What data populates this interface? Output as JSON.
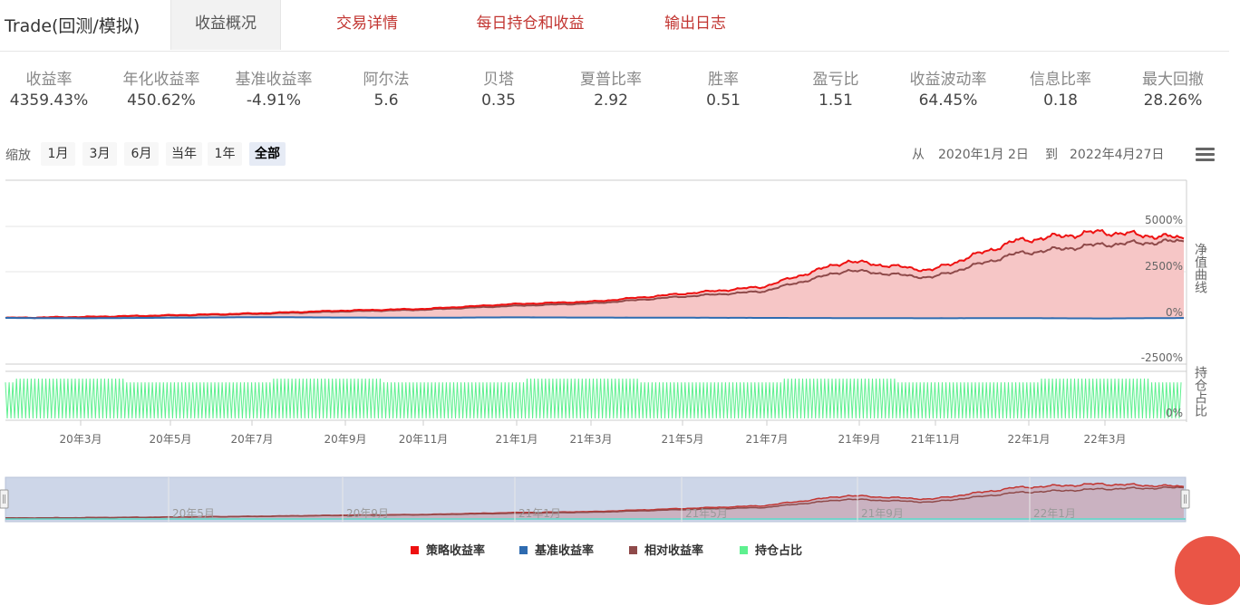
{
  "app_title": "Trade(回测/模拟)",
  "tabs": [
    {
      "label": "收益概况",
      "active": true
    },
    {
      "label": "交易详情",
      "active": false
    },
    {
      "label": "每日持仓和收益",
      "active": false
    },
    {
      "label": "输出日志",
      "active": false
    }
  ],
  "stats": [
    {
      "label": "收益率",
      "value": "4359.43%"
    },
    {
      "label": "年化收益率",
      "value": "450.62%"
    },
    {
      "label": "基准收益率",
      "value": "-4.91%"
    },
    {
      "label": "阿尔法",
      "value": "5.6"
    },
    {
      "label": "贝塔",
      "value": "0.35"
    },
    {
      "label": "夏普比率",
      "value": "2.92"
    },
    {
      "label": "胜率",
      "value": "0.51"
    },
    {
      "label": "盈亏比",
      "value": "1.51"
    },
    {
      "label": "收益波动率",
      "value": "64.45%"
    },
    {
      "label": "信息比率",
      "value": "0.18"
    },
    {
      "label": "最大回撤",
      "value": "28.26%"
    }
  ],
  "zoom": {
    "label": "缩放",
    "buttons": [
      "1月",
      "3月",
      "6月",
      "当年",
      "1年",
      "全部"
    ],
    "selected": "全部"
  },
  "range": {
    "from_label": "从",
    "from": "2020年1月 2日",
    "to_label": "到",
    "to": "2022年4月27日"
  },
  "colors": {
    "strategy": "#ee1111",
    "benchmark": "#2e6bb0",
    "relative": "#8f4a4a",
    "position": "#5ef08f",
    "area_fill": "#f6c6c6",
    "navigator_bg": "#cdd6e8",
    "accent": "#c23531"
  },
  "chart_data": {
    "type": "line",
    "right_axis_title": "净值曲线",
    "position_axis_title": "持仓占比",
    "y_ticks": [
      "5000%",
      "2500%",
      "0%",
      "-2500%"
    ],
    "position_tick": "0%",
    "ylim": [
      -2500,
      5000
    ],
    "x_ticks": [
      "20年3月",
      "20年5月",
      "20年7月",
      "20年9月",
      "20年11月",
      "21年1月",
      "21年3月",
      "21年5月",
      "21年7月",
      "21年9月",
      "21年11月",
      "22年1月",
      "22年3月"
    ],
    "navigator_ticks": [
      "20年5月",
      "20年9月",
      "21年1月",
      "21年5月",
      "21年9月",
      "22年1月"
    ],
    "x": [
      "2020-01",
      "2020-03",
      "2020-05",
      "2020-07",
      "2020-09",
      "2020-11",
      "2021-01",
      "2021-03",
      "2021-05",
      "2021-07",
      "2021-09",
      "2021-11",
      "2022-01",
      "2022-03",
      "2022-04"
    ],
    "series": [
      {
        "name": "策略收益率",
        "values": [
          0,
          60,
          150,
          250,
          400,
          500,
          750,
          900,
          1300,
          1700,
          3100,
          2600,
          4200,
          4700,
          4359
        ]
      },
      {
        "name": "基准收益率",
        "values": [
          0,
          -20,
          10,
          40,
          20,
          10,
          30,
          20,
          10,
          0,
          -10,
          -20,
          -10,
          -30,
          -5
        ]
      },
      {
        "name": "相对收益率",
        "values": [
          0,
          50,
          130,
          220,
          350,
          450,
          650,
          800,
          1150,
          1450,
          2600,
          2200,
          3500,
          4000,
          4200
        ]
      }
    ],
    "legend": [
      "策略收益率",
      "基准收益率",
      "相对收益率",
      "持仓占比"
    ],
    "legend_position": "bottom",
    "grid": true
  }
}
